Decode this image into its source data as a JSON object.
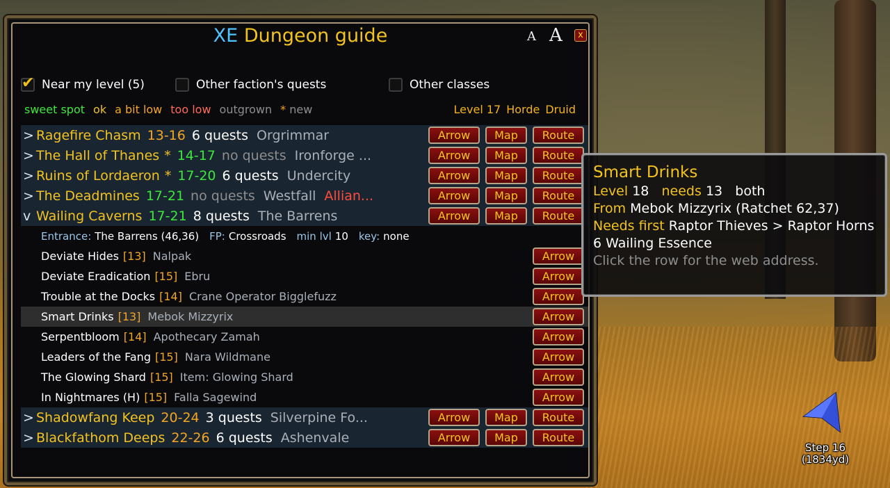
{
  "window": {
    "title_prefix": "XE",
    "title_main": "Dungeon guide",
    "font_small": "A",
    "font_large": "A",
    "close": "x"
  },
  "options": {
    "near_level": {
      "label": "Near my level (5)",
      "checked": true
    },
    "other_faction": {
      "label": "Other faction's quests",
      "checked": false
    },
    "other_classes": {
      "label": "Other classes",
      "checked": false
    }
  },
  "legend": {
    "items": [
      {
        "text": "sweet spot",
        "color": "#3ce83c"
      },
      {
        "text": "ok",
        "color": "#f2c320"
      },
      {
        "text": "a bit low",
        "color": "#f5a623"
      },
      {
        "text": "too low",
        "color": "#ff6a5a"
      },
      {
        "text": "outgrown",
        "color": "#8e8e8e"
      },
      {
        "text": "* new",
        "color": "#8e8e8e"
      }
    ],
    "level": "Level 17",
    "faction": "Horde",
    "class": "Druid"
  },
  "buttons": {
    "arrow": "Arrow",
    "map": "Map",
    "route": "Route"
  },
  "dungeons_top": [
    {
      "toggle": ">",
      "name": "Ragefire Chasm",
      "star": "",
      "levels": "13-16",
      "level_color": "orange",
      "quests": "6 quests",
      "has_quests": true,
      "zone": "Orgrimmar",
      "faction": ""
    },
    {
      "toggle": ">",
      "name": "The Hall of Thanes",
      "star": "*",
      "levels": "14-17",
      "level_color": "green",
      "quests": "no quests",
      "has_quests": false,
      "zone": "Ironforge ...",
      "faction": ""
    },
    {
      "toggle": ">",
      "name": "Ruins of Lordaeron",
      "star": "*",
      "levels": "17-20",
      "level_color": "green",
      "quests": "6 quests",
      "has_quests": true,
      "zone": "Undercity",
      "faction": ""
    },
    {
      "toggle": ">",
      "name": "The Deadmines",
      "star": "",
      "levels": "17-21",
      "level_color": "green",
      "quests": "no quests",
      "has_quests": false,
      "zone": "Westfall",
      "faction": "Allian..."
    },
    {
      "toggle": "v",
      "name": "Wailing Caverns",
      "star": "",
      "levels": "17-21",
      "level_color": "green",
      "quests": "8 quests",
      "has_quests": true,
      "zone": "The Barrens",
      "faction": ""
    }
  ],
  "expanded_info": {
    "entrance_label": "Entrance:",
    "entrance_value": "The Barrens (46,36)",
    "fp_label": "FP:",
    "fp_value": "Crossroads",
    "minlvl_label": "min lvl",
    "minlvl_value": "10",
    "key_label": "key:",
    "key_value": "none"
  },
  "quests": [
    {
      "name": "Deviate Hides",
      "level": "[13]",
      "giver": "Nalpak"
    },
    {
      "name": "Deviate Eradication",
      "level": "[15]",
      "giver": "Ebru"
    },
    {
      "name": "Trouble at the Docks",
      "level": "[14]",
      "giver": "Crane Operator Bigglefuzz"
    },
    {
      "name": "Smart Drinks",
      "level": "[13]",
      "giver": "Mebok Mizzyrix",
      "highlight": true
    },
    {
      "name": "Serpentbloom",
      "level": "[14]",
      "giver": "Apothecary Zamah"
    },
    {
      "name": "Leaders of the Fang",
      "level": "[15]",
      "giver": "Nara Wildmane"
    },
    {
      "name": "The Glowing Shard",
      "level": "[15]",
      "giver": "Item: Glowing Shard"
    },
    {
      "name": "In Nightmares (H)",
      "level": "[15]",
      "giver": "Falla Sagewind"
    }
  ],
  "dungeons_bottom": [
    {
      "toggle": ">",
      "name": "Shadowfang Keep",
      "star": "",
      "levels": "20-24",
      "level_color": "orange",
      "quests": "3 quests",
      "has_quests": true,
      "zone": "Silverpine Fo...",
      "faction": ""
    },
    {
      "toggle": ">",
      "name": "Blackfathom Deeps",
      "star": "",
      "levels": "22-26",
      "level_color": "orange",
      "quests": "6 quests",
      "has_quests": true,
      "zone": "Ashenvale",
      "faction": ""
    }
  ],
  "tooltip": {
    "title": "Smart Drinks",
    "level_k": "Level",
    "level_v": "18",
    "needs_k": "needs",
    "needs_v": "13",
    "both": "both",
    "from_k": "From",
    "from_v": "Mebok Mizzyrix (Ratchet 62,37)",
    "needs_first_k": "Needs first",
    "needs_first_v": "Raptor Thieves > Raptor Horns",
    "item": "6 Wailing Essence",
    "hint": "Click the row for the web address."
  },
  "nav": {
    "step": "Step 16",
    "distance": "(1834yd)"
  }
}
